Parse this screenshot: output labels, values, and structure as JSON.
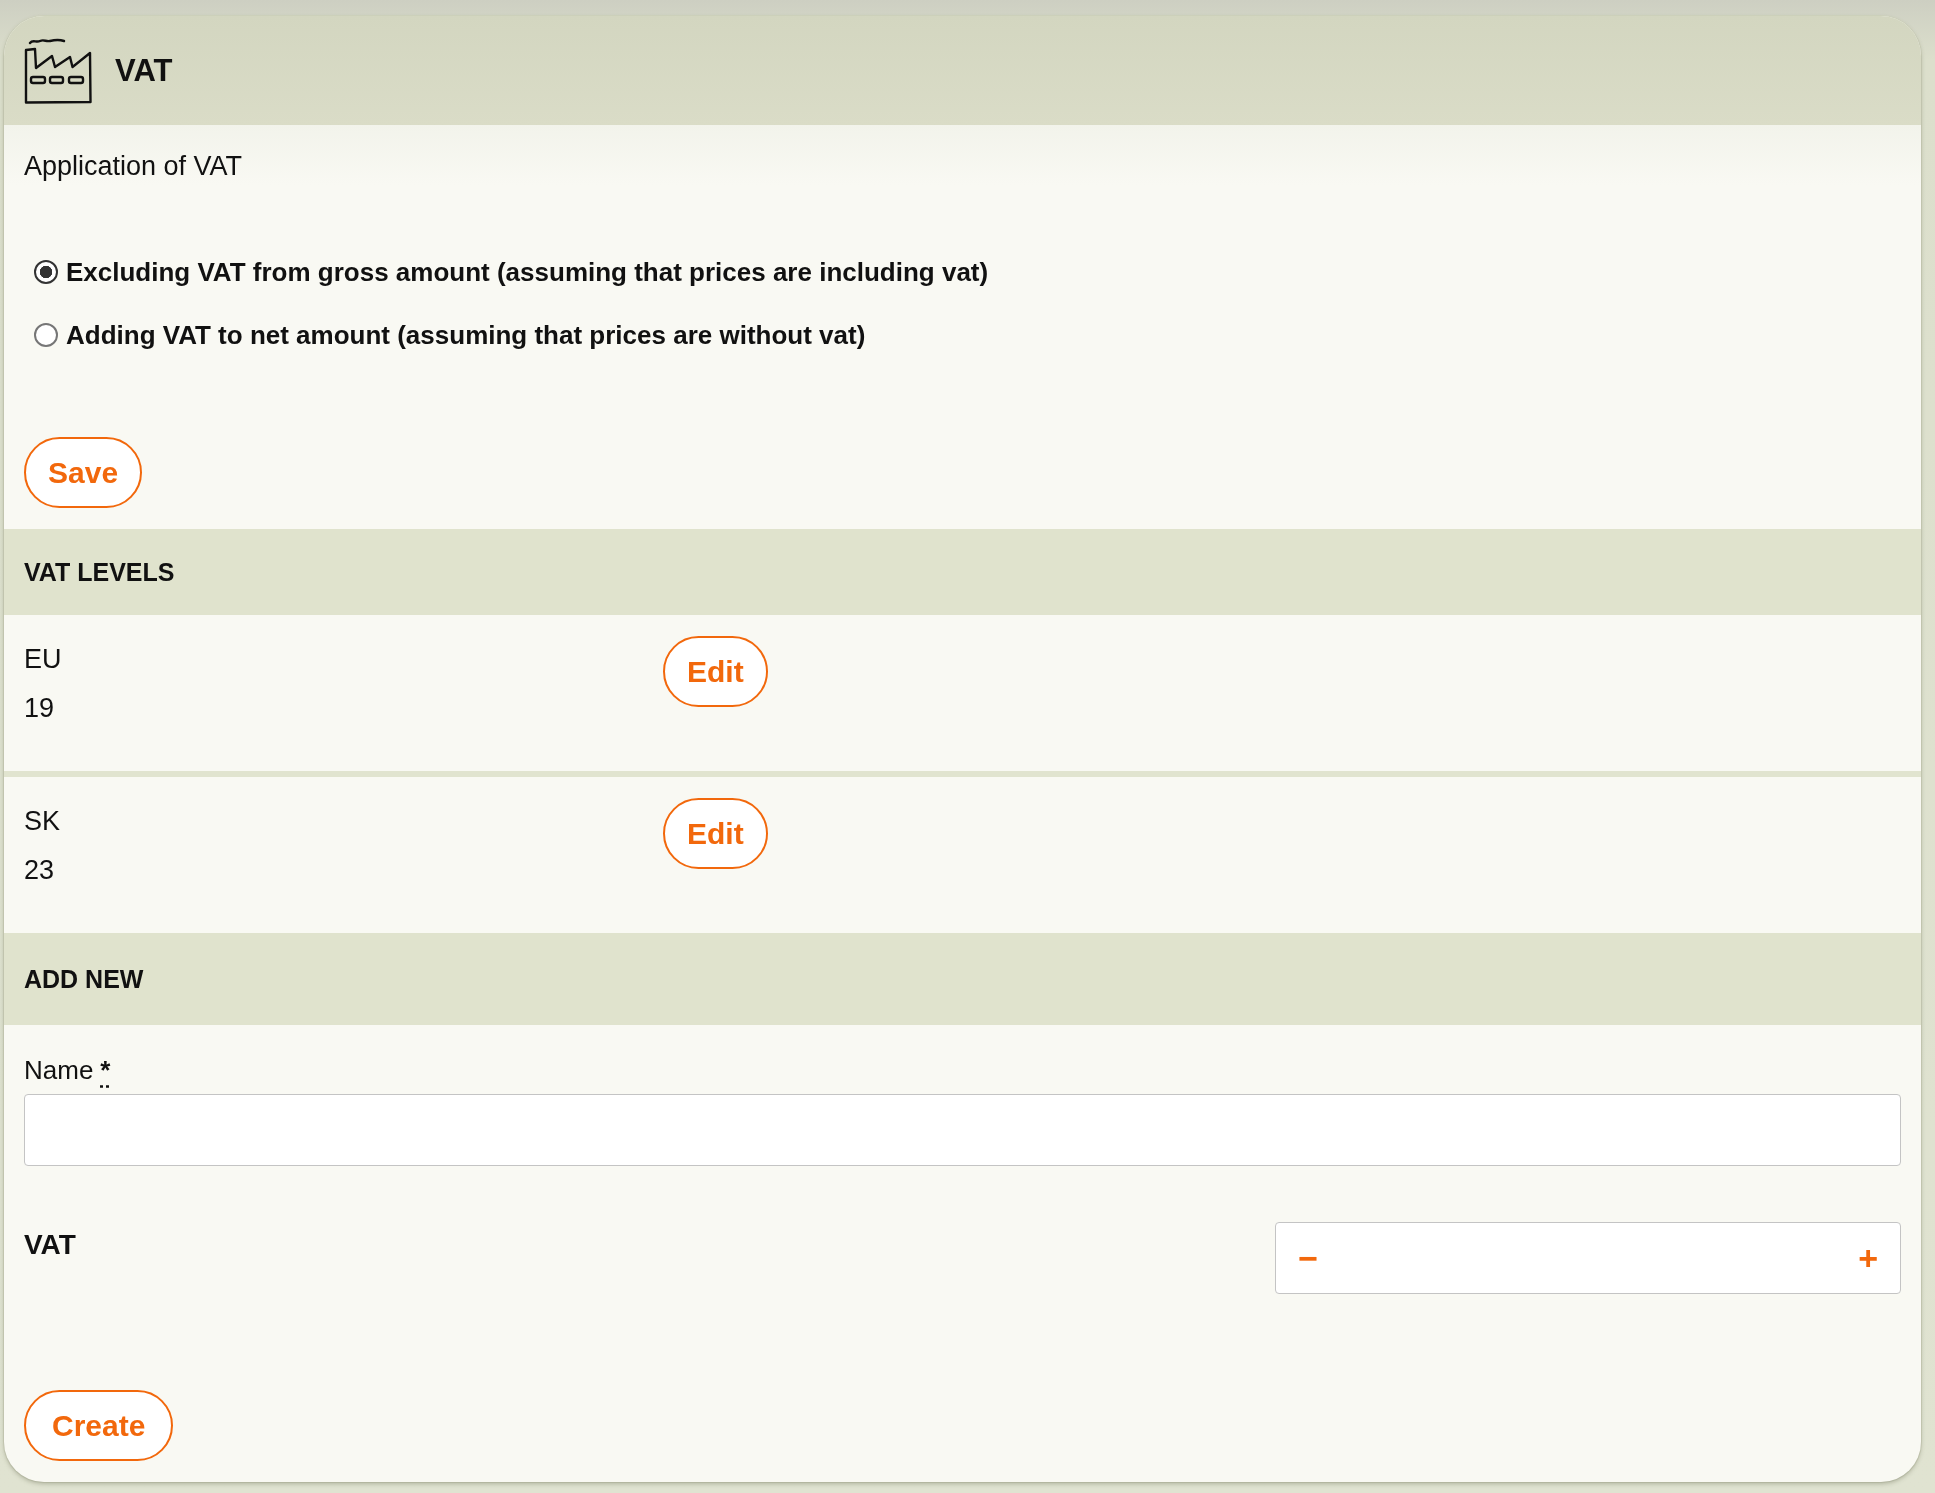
{
  "card": {
    "title": "VAT"
  },
  "application": {
    "label": "Application of VAT",
    "options": [
      {
        "label": "Excluding VAT from gross amount (assuming that prices are including vat)",
        "selected": true
      },
      {
        "label": "Adding VAT to net amount (assuming that prices are without vat)",
        "selected": false
      }
    ],
    "save_button": "Save"
  },
  "vat_levels": {
    "heading": "VAT LEVELS",
    "rows": [
      {
        "name": "EU",
        "rate": "19",
        "button": "Edit"
      },
      {
        "name": "SK",
        "rate": "23",
        "button": "Edit"
      }
    ]
  },
  "add_new": {
    "heading": "ADD NEW",
    "name_field": {
      "label": "Name",
      "required_mark": "*"
    },
    "vat_field": {
      "label": "VAT",
      "decrement": "−",
      "increment": "+"
    },
    "create_button": "Create"
  }
}
